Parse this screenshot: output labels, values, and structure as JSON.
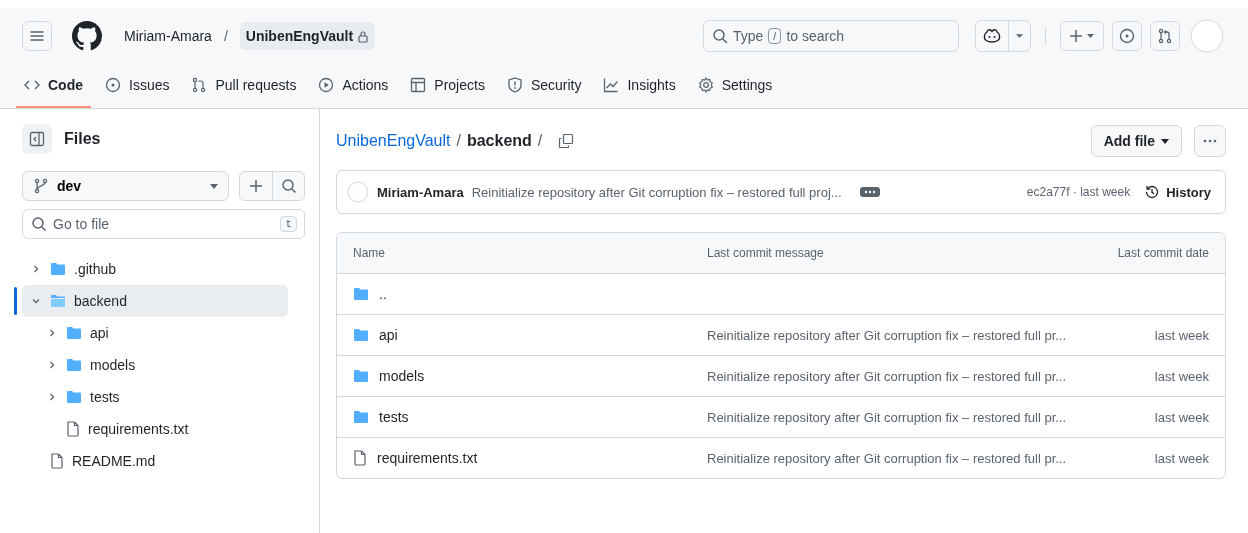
{
  "header": {
    "owner": "Miriam-Amara",
    "separator": "/",
    "repo": "UnibenEngVault",
    "search": {
      "before": "Type",
      "key": "/",
      "after": "to search"
    }
  },
  "tabs": [
    {
      "label": "Code",
      "kind": "code",
      "selected": true
    },
    {
      "label": "Issues",
      "kind": "issue",
      "selected": false
    },
    {
      "label": "Pull requests",
      "kind": "pr",
      "selected": false
    },
    {
      "label": "Actions",
      "kind": "play",
      "selected": false
    },
    {
      "label": "Projects",
      "kind": "table",
      "selected": false
    },
    {
      "label": "Security",
      "kind": "shield",
      "selected": false
    },
    {
      "label": "Insights",
      "kind": "graph",
      "selected": false
    },
    {
      "label": "Settings",
      "kind": "gear",
      "selected": false
    }
  ],
  "sidebar": {
    "title": "Files",
    "branch": "dev",
    "filter": {
      "placeholder": "Go to file",
      "key": "t"
    },
    "tree": [
      {
        "name": ".github",
        "kind": "folder",
        "expanded": false,
        "selected": false
      },
      {
        "name": "backend",
        "kind": "folder",
        "expanded": true,
        "selected": true,
        "children": [
          {
            "name": "api",
            "kind": "folder",
            "expanded": false,
            "selected": false
          },
          {
            "name": "models",
            "kind": "folder",
            "expanded": false,
            "selected": false
          },
          {
            "name": "tests",
            "kind": "folder",
            "expanded": false,
            "selected": false
          },
          {
            "name": "requirements.txt",
            "kind": "file",
            "selected": false
          }
        ]
      },
      {
        "name": "README.md",
        "kind": "file",
        "selected": false
      }
    ]
  },
  "breadcrumb": {
    "repo": "UnibenEngVault",
    "separator": "/",
    "folder": "backend",
    "trailing": "/"
  },
  "add_file": "Add file",
  "commit": {
    "author": "Miriam-Amara",
    "message": "Reinitialize repository after Git corruption fix – restored full proj...",
    "hash": "ec2a77f · last week",
    "history": "History"
  },
  "table": {
    "columns": [
      "Name",
      "Last commit message",
      "Last commit date"
    ],
    "rows": [
      {
        "name": "..",
        "kind": "folder"
      },
      {
        "name": "api",
        "kind": "folder",
        "message": "Reinitialize repository after Git corruption fix – restored full pr...",
        "date": "last week"
      },
      {
        "name": "models",
        "kind": "folder",
        "message": "Reinitialize repository after Git corruption fix – restored full pr...",
        "date": "last week"
      },
      {
        "name": "tests",
        "kind": "folder",
        "message": "Reinitialize repository after Git corruption fix – restored full pr...",
        "date": "last week"
      },
      {
        "name": "requirements.txt",
        "kind": "file",
        "message": "Reinitialize repository after Git corruption fix – restored full pr...",
        "date": "last week"
      }
    ]
  }
}
